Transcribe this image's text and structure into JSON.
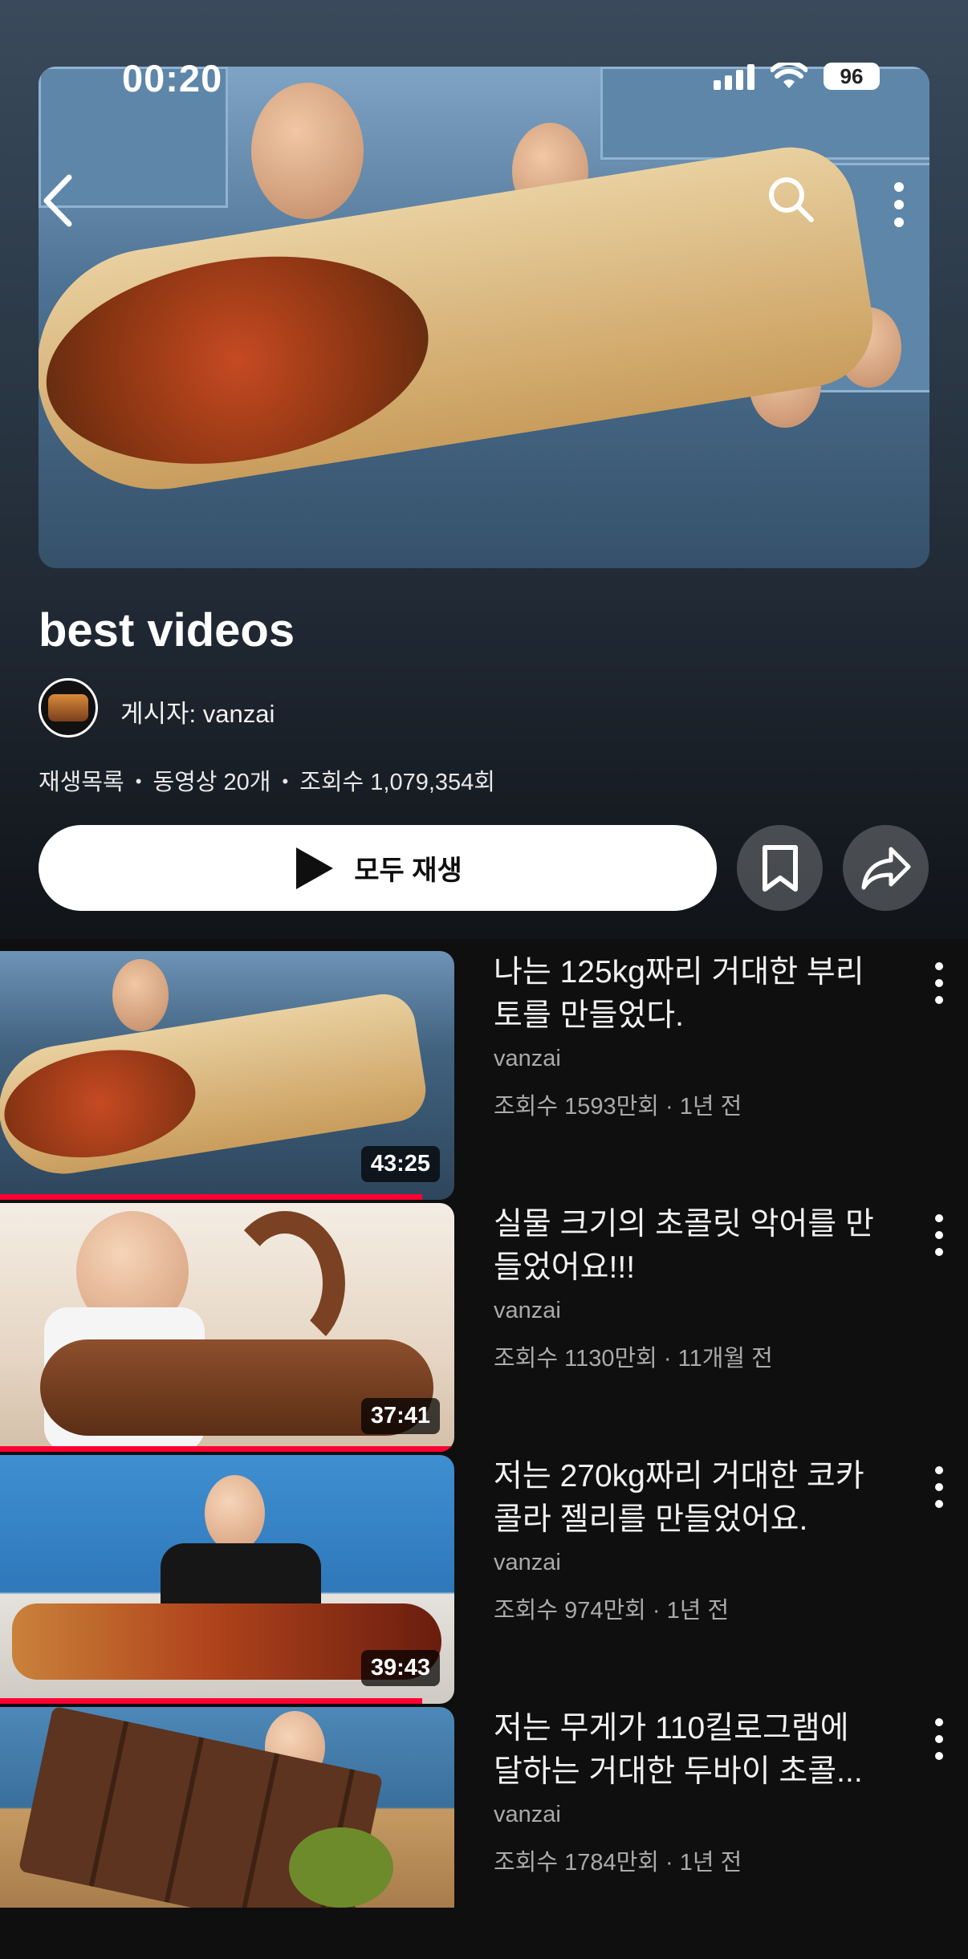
{
  "status_bar": {
    "time": "00:20",
    "battery": "96"
  },
  "header": {
    "back_icon": "chevron-left-icon",
    "search_icon": "search-icon",
    "more_icon": "more-vertical-icon"
  },
  "playlist": {
    "title": "best videos",
    "author": "게시자: vanzai",
    "type": "재생목록",
    "video_count": "동영상 20개",
    "views": "조회수 1,079,354회",
    "play_all_label": "모두 재생"
  },
  "videos": [
    {
      "title": "나는 125kg짜리 거대한 부리토를 만들었다.",
      "channel": "vanzai",
      "stats": "조회수 1593만회 · 1년 전",
      "duration": "43:25",
      "progress": 0.93
    },
    {
      "title": "실물 크기의 초콜릿 악어를 만들었어요!!!",
      "channel": "vanzai",
      "stats": "조회수 1130만회 · 11개월 전",
      "duration": "37:41",
      "progress": 1.0
    },
    {
      "title": "저는 270kg짜리 거대한 코카콜라 젤리를 만들었어요.",
      "channel": "vanzai",
      "stats": "조회수 974만회 · 1년 전",
      "duration": "39:43",
      "progress": 0.93
    },
    {
      "title": "저는 무게가 110킬로그램에 달하는 거대한 두바이 초콜...",
      "channel": "vanzai",
      "stats": "조회수 1784만회 · 1년 전",
      "duration": "",
      "progress": 0
    }
  ]
}
